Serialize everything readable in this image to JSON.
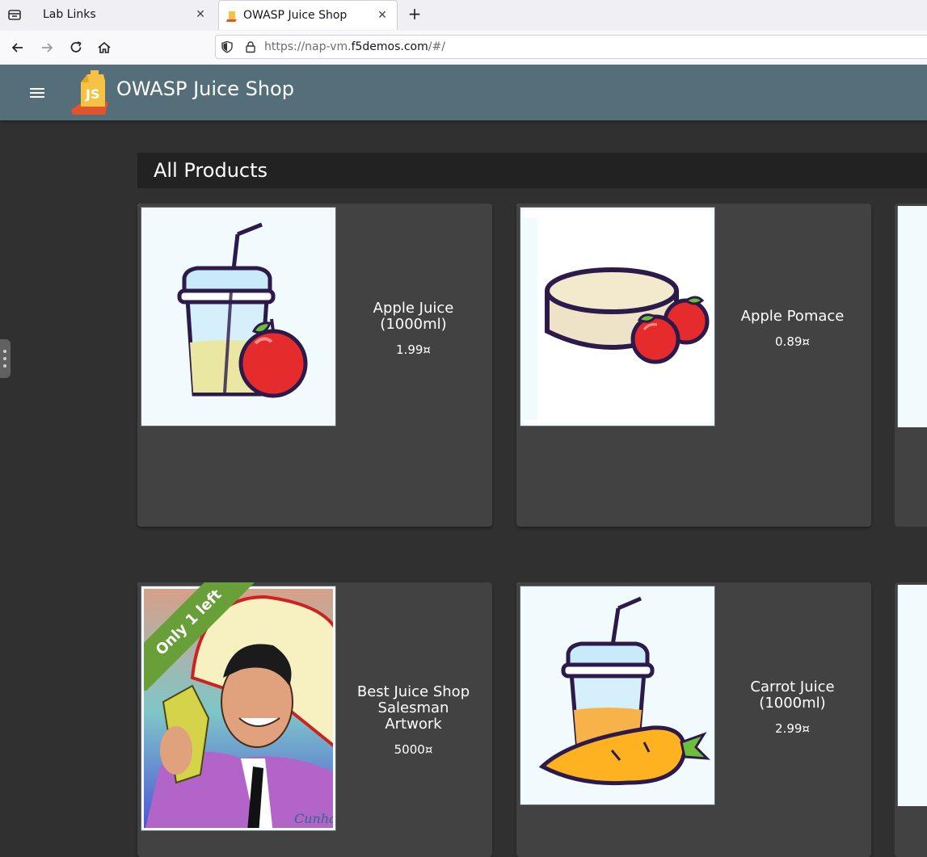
{
  "browser": {
    "tabs": [
      {
        "title": "Lab Links",
        "active": false
      },
      {
        "title": "OWASP Juice Shop",
        "active": true
      }
    ],
    "url": {
      "prefix": "https://nap-vm.",
      "host": "f5demos.com",
      "suffix": "/#/"
    }
  },
  "app": {
    "title": "OWASP Juice Shop",
    "toolbar_color": "#546e7a"
  },
  "page": {
    "heading": "All Products"
  },
  "products": [
    {
      "name_lines": [
        "Apple Juice",
        "(1000ml)"
      ],
      "price": "1.99¤",
      "image": "juice-cup-apple-icon"
    },
    {
      "name_lines": [
        "Apple Pomace"
      ],
      "price": "0.89¤",
      "image": "pomace-apples-icon"
    },
    {
      "name_lines": [
        "Best Juice Shop",
        "Salesman",
        "Artwork"
      ],
      "price": "5000¤",
      "image": "salesman-artwork",
      "ribbon": "Only 1 left",
      "ribbon_color": "#689f38"
    },
    {
      "name_lines": [
        "Carrot Juice",
        "(1000ml)"
      ],
      "price": "2.99¤",
      "image": "juice-cup-carrot-icon"
    }
  ]
}
